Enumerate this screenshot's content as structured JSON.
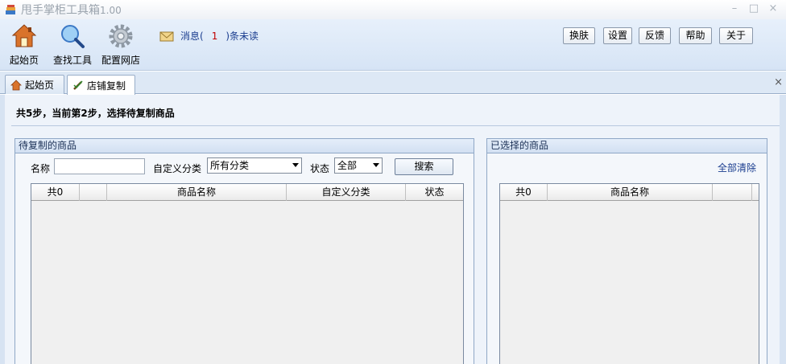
{
  "window": {
    "title": "甩手掌柜工具箱",
    "version": "1.00",
    "minimize": "–",
    "maximize": "□",
    "close": "×"
  },
  "toolbar": {
    "tools": [
      {
        "label": "起始页",
        "icon": "home-icon"
      },
      {
        "label": "查找工具",
        "icon": "search-icon"
      },
      {
        "label": "配置网店",
        "icon": "gear-icon"
      }
    ],
    "message": {
      "prefix": "消息(",
      "count": "1",
      "suffix": ")条未读",
      "icon": "envelope-icon"
    },
    "buttons": [
      "换肤",
      "设置",
      "反馈",
      "帮助",
      "关于"
    ]
  },
  "tabs": [
    {
      "label": "起始页",
      "icon": "home-icon",
      "active": false
    },
    {
      "label": "店铺复制",
      "icon": "pen-icon",
      "active": true
    }
  ],
  "tab_close": "×",
  "step_text": "共5步，当前第2步，选择待复制商品",
  "left_panel": {
    "title": "待复制的商品",
    "name_label": "名称",
    "name_value": "",
    "category_label": "自定义分类",
    "category_value": "所有分类",
    "status_label": "状态",
    "status_value": "全部",
    "search_button": "搜索",
    "columns": [
      "共0",
      "",
      "商品名称",
      "自定义分类",
      "状态"
    ]
  },
  "right_panel": {
    "title": "已选择的商品",
    "clear_all": "全部清除",
    "columns": [
      "共0",
      "商品名称",
      ""
    ]
  },
  "colors": {
    "accent": "#1a3d8f",
    "count": "#c00000",
    "toolbar_bg": "#d6e4f5"
  }
}
